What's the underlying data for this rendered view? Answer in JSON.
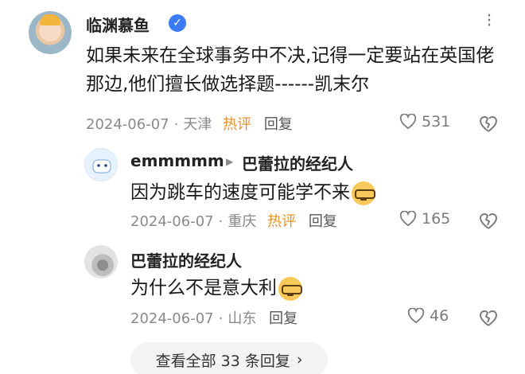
{
  "main_comment": {
    "username": "临渊慕鱼",
    "verified_icon": "verified-badge-icon",
    "content": "如果未来在全球事务中不决,记得一定要站在英国佬那边,他们擅长做选择题------凯末尔",
    "date": "2024-06-07",
    "location": "天津",
    "hot_label": "热评",
    "reply_label": "回复",
    "likes": "531"
  },
  "replies": [
    {
      "username": "emmmmm",
      "reply_to": "巴蕾拉的经纪人",
      "content": "因为跳车的速度可能学不来",
      "emoji": "glasses-emoji",
      "date": "2024-06-07",
      "location": "重庆",
      "hot_label": "热评",
      "reply_label": "回复",
      "likes": "165"
    },
    {
      "username": "巴蕾拉的经纪人",
      "content": "为什么不是意大利",
      "emoji": "glasses-emoji",
      "date": "2024-06-07",
      "location": "山东",
      "reply_label": "回复",
      "likes": "46"
    }
  ],
  "view_more": {
    "label": "查看全部 33 条回复",
    "chevron": "›"
  },
  "colors": {
    "hot": "#e5932f",
    "verified": "#3b7bf6",
    "meta": "#8a8a8a"
  }
}
